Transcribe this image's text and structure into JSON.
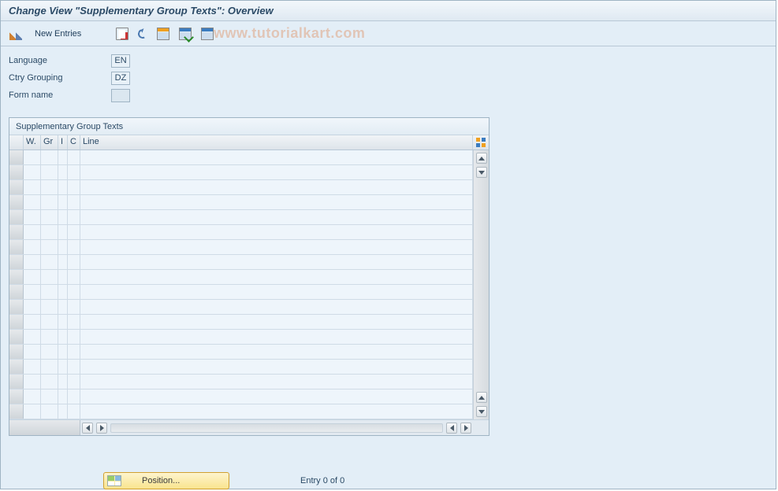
{
  "title": "Change View \"Supplementary Group Texts\": Overview",
  "watermark": "www.tutorialkart.com",
  "toolbar": {
    "new_entries_label": "New Entries"
  },
  "form": {
    "language_label": "Language",
    "language_value": "EN",
    "ctry_label": "Ctry Grouping",
    "ctry_value": "DZ",
    "form_name_label": "Form name",
    "form_name_value": ""
  },
  "grid": {
    "panel_title": "Supplementary Group Texts",
    "columns": {
      "w": "W.",
      "gr": "Gr",
      "i": "I",
      "c": "C",
      "line": "Line"
    },
    "row_count": 18,
    "rows": []
  },
  "footer": {
    "position_label": "Position...",
    "entry_text": "Entry 0 of 0"
  }
}
